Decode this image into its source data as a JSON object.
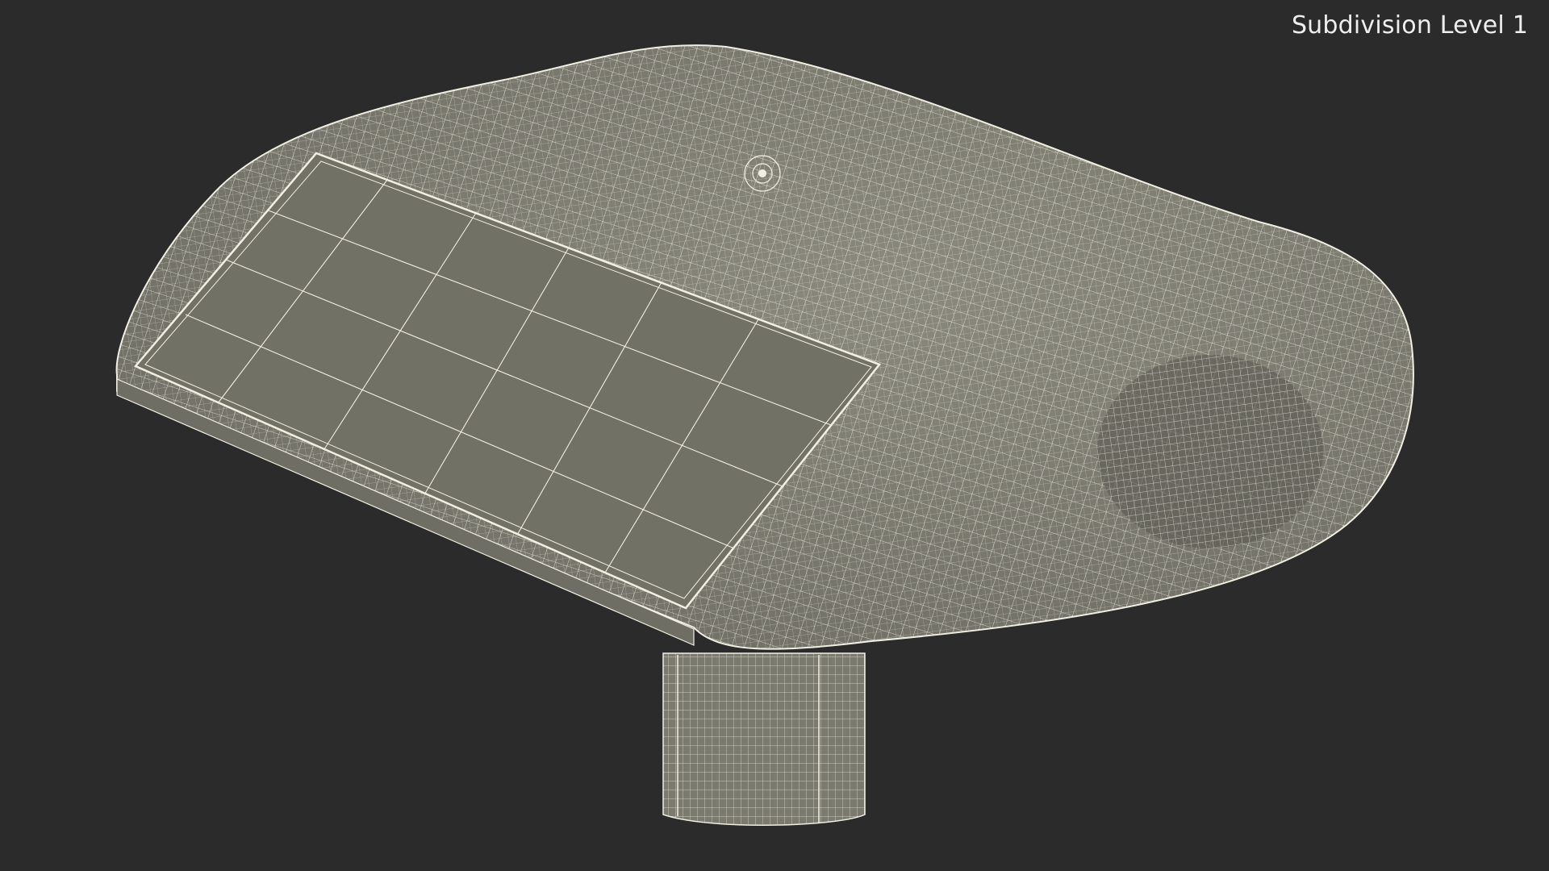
{
  "viewport": {
    "overlay_label": "Subdivision Level 1",
    "background_color": "#2b2b2b"
  },
  "model": {
    "surface_color": "#7b7a6f",
    "wire_color": "#f1efe2"
  }
}
